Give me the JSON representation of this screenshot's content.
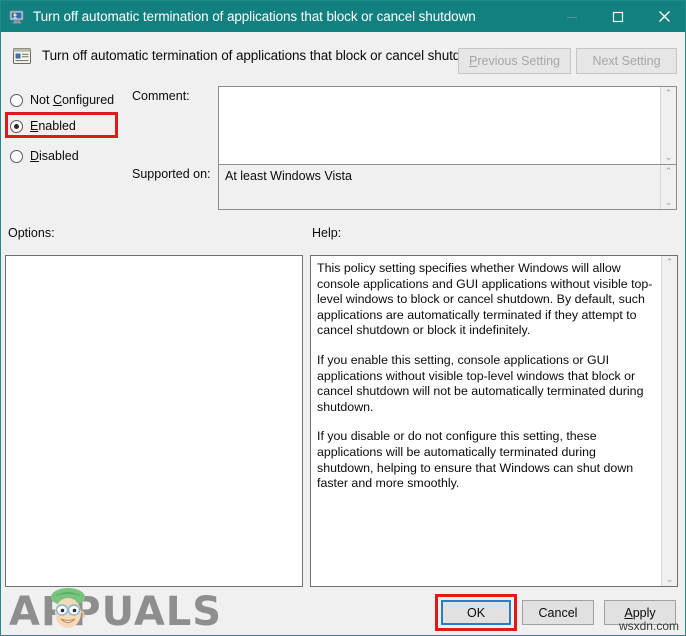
{
  "window": {
    "title": "Turn off automatic termination of applications that block or cancel shutdown",
    "title_icon": "monitor-policy-icon",
    "minimize_label": "—",
    "maximize_label": "□",
    "close_label": "✕",
    "border_color": "#1b8b8b",
    "titlebar_color": "#12807f"
  },
  "header": {
    "policy_icon": "group-policy-setting-icon",
    "policy_title": "Turn off automatic termination of applications that block or cancel shutdown",
    "previous_setting": "Previous Setting",
    "previous_mnemonic": "P",
    "next_setting": "Next Setting",
    "buttons_enabled": false
  },
  "state_options": {
    "items": [
      {
        "label": "Not Configured",
        "mnemonic": "C",
        "selected": false
      },
      {
        "label": "Enabled",
        "mnemonic": "E",
        "selected": true
      },
      {
        "label": "Disabled",
        "mnemonic": "D",
        "selected": false
      }
    ],
    "selected_value": "Enabled"
  },
  "fields": {
    "comment_label": "Comment:",
    "comment_value": "",
    "supported_label": "Supported on:",
    "supported_value": "At least Windows Vista"
  },
  "panels": {
    "options_label": "Options:",
    "options_content": "",
    "help_label": "Help:",
    "help_paragraphs": [
      "This policy setting specifies whether Windows will allow console applications and GUI applications without visible top-level windows to block or cancel shutdown. By default, such applications are automatically terminated if they attempt to cancel shutdown or block it indefinitely.",
      "If you enable this setting, console applications or GUI applications without visible top-level windows that block or cancel shutdown will not be automatically terminated during shutdown.",
      "If you disable or do not configure this setting, these applications will be automatically terminated during shutdown, helping to ensure that Windows can shut down faster and more smoothly."
    ]
  },
  "footer": {
    "ok_label": "OK",
    "cancel_label": "Cancel",
    "apply_label": "Apply",
    "apply_mnemonic": "A",
    "ok_focused": true
  },
  "annotations": {
    "highlight_color": "#e0191b",
    "focus_ring_color": "#2b7dc0",
    "highlighted_items": [
      "Enabled",
      "OK"
    ]
  },
  "watermarks": {
    "brand": "APPUALS",
    "brand_color": "#8e8e8e",
    "site": "wsxdn.com"
  },
  "scrollbar": {
    "up_arrow": "⌃",
    "down_arrow": "⌄"
  }
}
